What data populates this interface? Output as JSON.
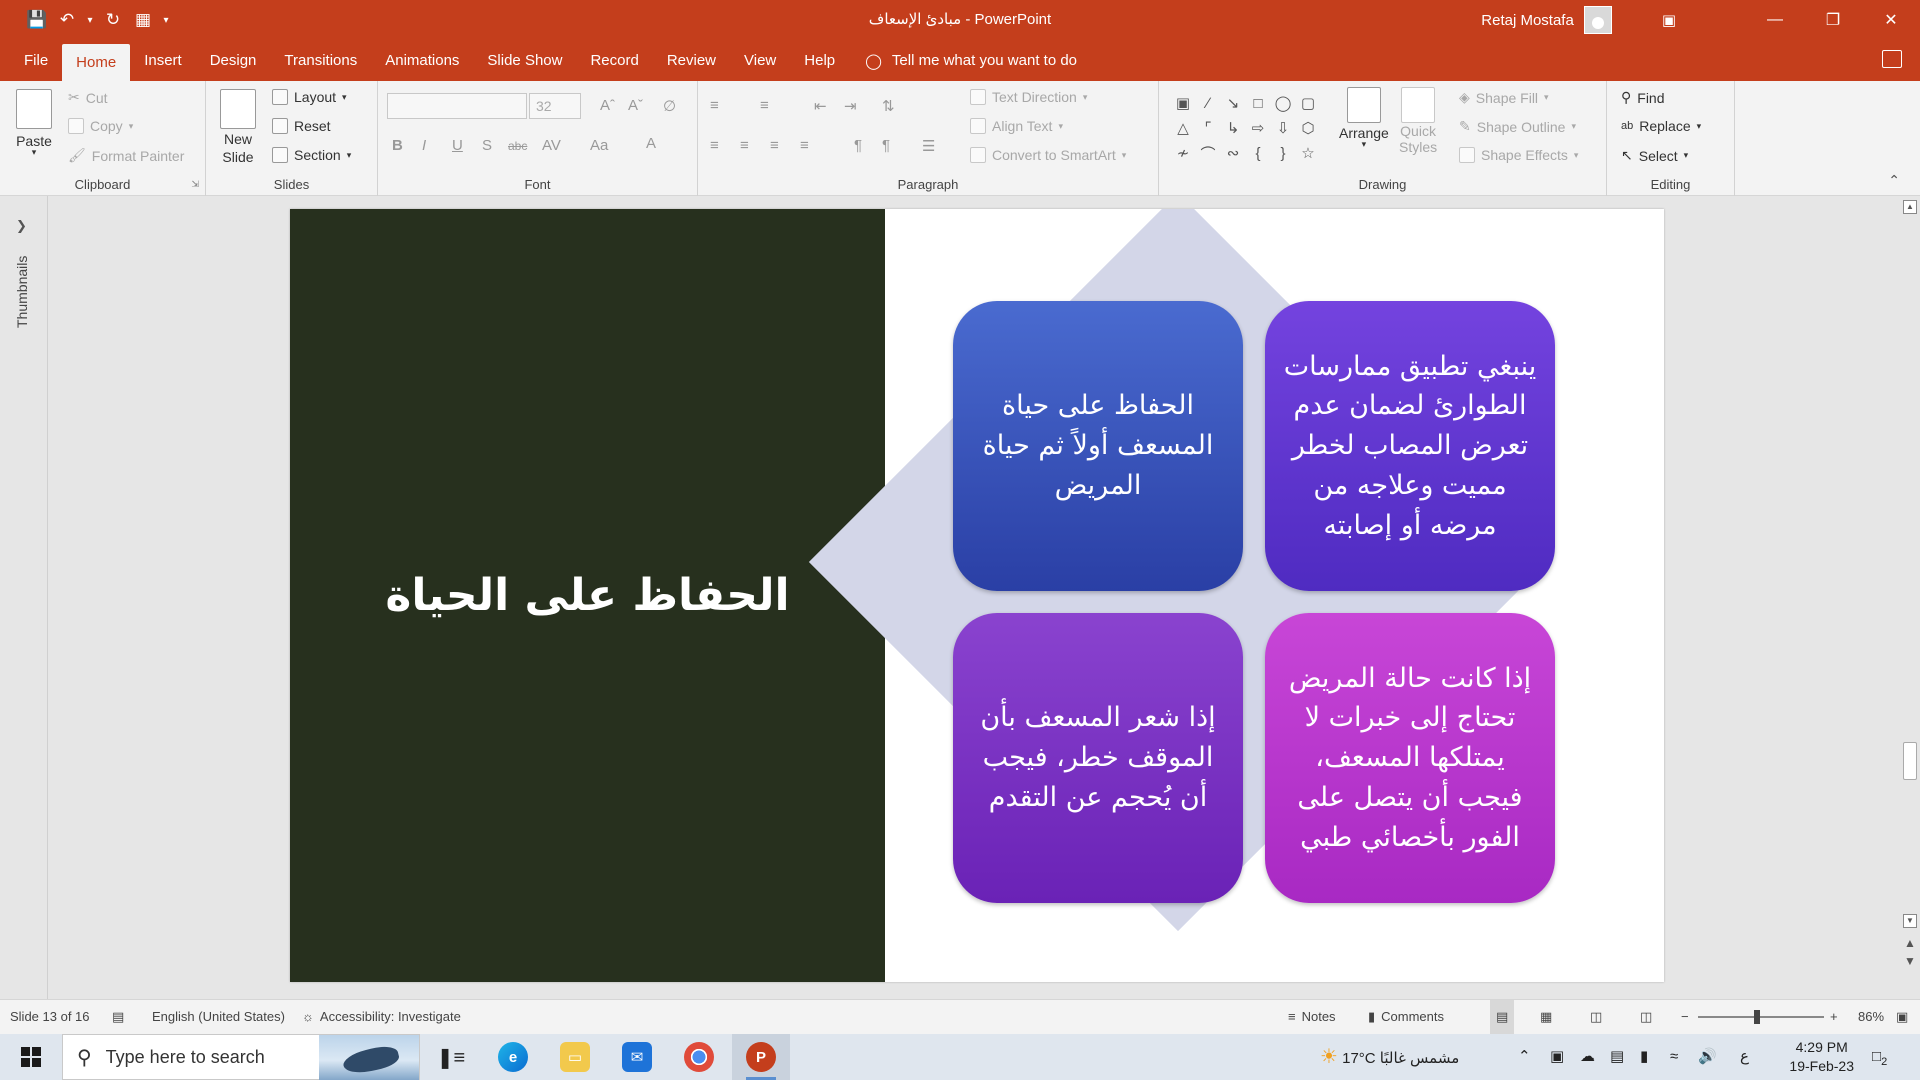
{
  "window": {
    "title": "مبادئ الإسعاف  -  PowerPoint",
    "user_name": "Retaj Mostafa"
  },
  "menu": {
    "tabs": [
      "File",
      "Home",
      "Insert",
      "Design",
      "Transitions",
      "Animations",
      "Slide Show",
      "Record",
      "Review",
      "View",
      "Help"
    ],
    "active_tab": "Home",
    "tell_me": "Tell me what you want to do"
  },
  "ribbon": {
    "clipboard": {
      "label": "Clipboard",
      "paste": "Paste",
      "cut": "Cut",
      "copy": "Copy",
      "format_painter": "Format Painter"
    },
    "slides": {
      "label": "Slides",
      "new_slide_line1": "New",
      "new_slide_line2": "Slide",
      "layout": "Layout",
      "reset": "Reset",
      "section": "Section"
    },
    "font": {
      "label": "Font",
      "size": "32"
    },
    "paragraph": {
      "label": "Paragraph",
      "text_direction": "Text Direction",
      "align_text": "Align Text",
      "convert_smartart": "Convert to SmartArt"
    },
    "drawing": {
      "label": "Drawing",
      "arrange": "Arrange",
      "quick_styles_line1": "Quick",
      "quick_styles_line2": "Styles",
      "shape_fill": "Shape Fill",
      "shape_outline": "Shape Outline",
      "shape_effects": "Shape Effects"
    },
    "editing": {
      "label": "Editing",
      "find": "Find",
      "replace": "Replace",
      "select": "Select"
    }
  },
  "thumbnails_label": "Thumbnails",
  "slide": {
    "title": "الحفاظ على الحياة",
    "boxes": [
      "الحفاظ على حياة المسعف أولاً ثم حياة المريض",
      "ينبغي تطبيق ممارسات الطوارئ لضمان عدم تعرض المصاب لخطر مميت وعلاجه من مرضه أو إصابته",
      "إذا شعر المسعف بأن الموقف خطر، فيجب أن يُحجم عن التقدم",
      "إذا كانت حالة المريض تحتاج إلى خبرات لا يمتلكها المسعف، فيجب أن يتصل على الفور بأخصائي طبي"
    ]
  },
  "status": {
    "slide_info": "Slide 13 of 16",
    "language": "English (United States)",
    "accessibility": "Accessibility: Investigate",
    "notes": "Notes",
    "comments": "Comments",
    "zoom": "86%"
  },
  "taskbar": {
    "search_placeholder": "Type here to search",
    "weather_temp": "17°C",
    "weather_desc": "مشمس غالبًا",
    "input_lang": "ع",
    "time": "4:29 PM",
    "date": "19-Feb-23",
    "notif_count": "2"
  },
  "colors": {
    "accent": "#c43e1c",
    "slide_left_bg": "#27301e",
    "diamond": "#d3d6e8"
  }
}
